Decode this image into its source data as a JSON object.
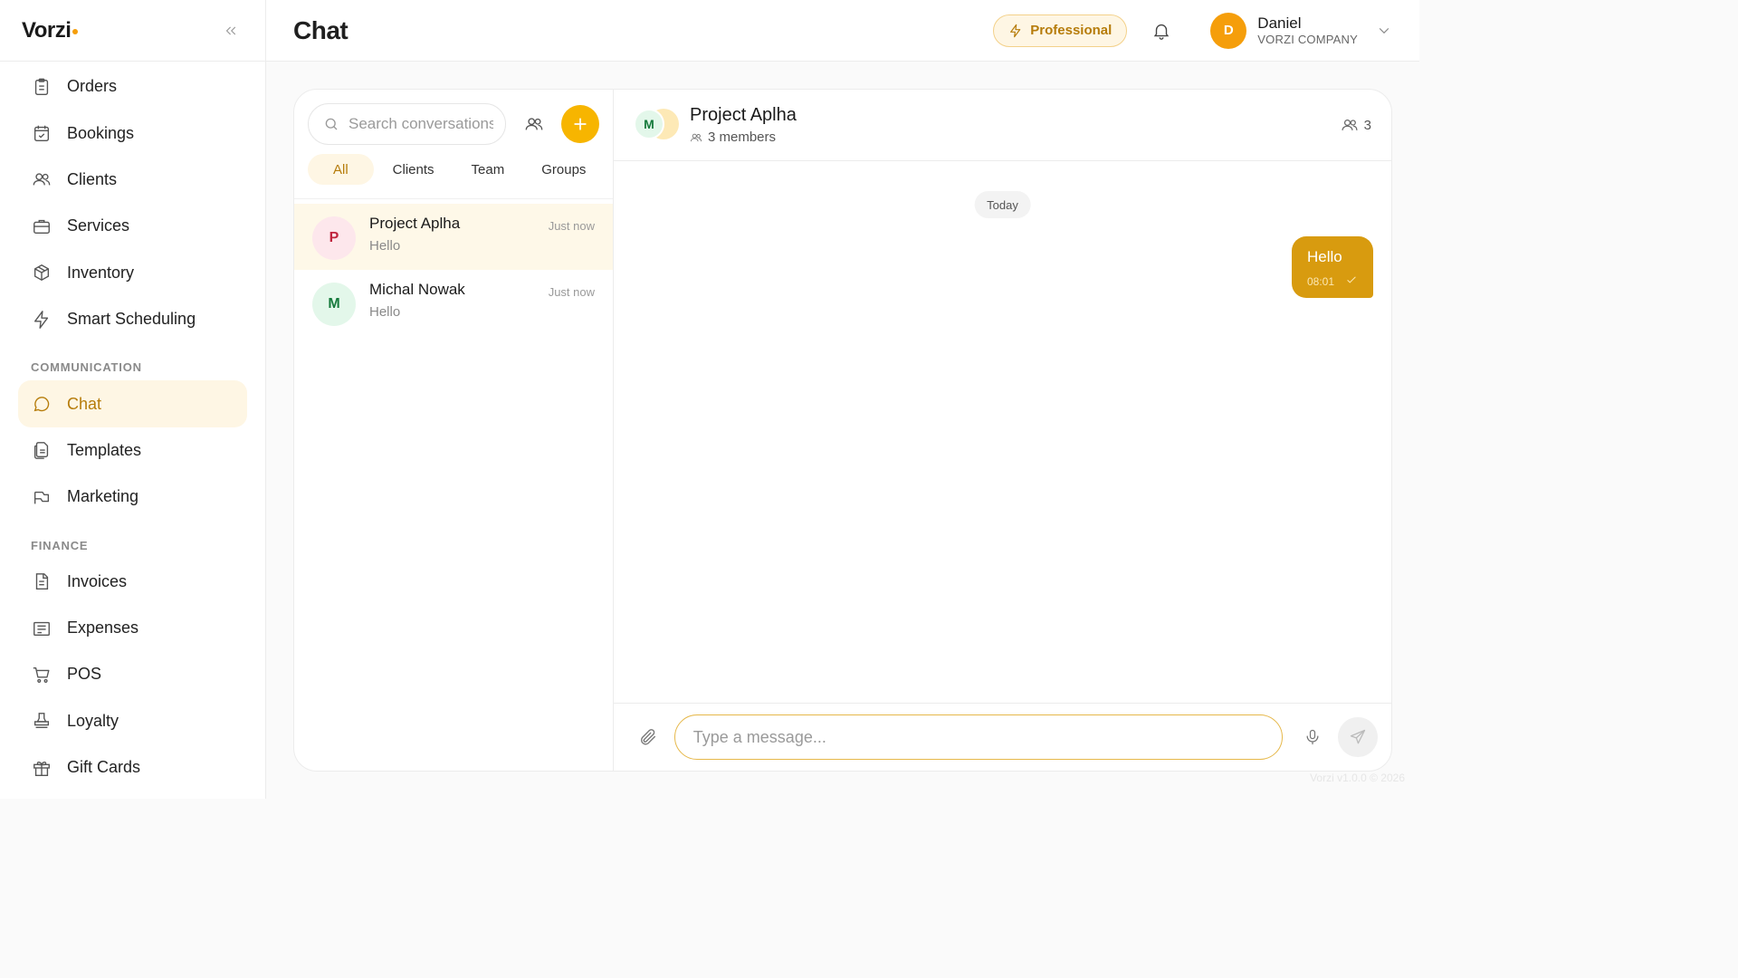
{
  "brand": {
    "name": "Vorzi",
    "accent": "#f59e0b"
  },
  "sidebar": {
    "items_top": [
      {
        "label": "Orders",
        "icon": "clipboard-icon"
      },
      {
        "label": "Bookings",
        "icon": "calendar-check-icon"
      },
      {
        "label": "Clients",
        "icon": "users-icon"
      },
      {
        "label": "Services",
        "icon": "briefcase-icon"
      },
      {
        "label": "Inventory",
        "icon": "box-icon"
      },
      {
        "label": "Smart Scheduling",
        "icon": "bolt-icon"
      }
    ],
    "section_communication": "COMMUNICATION",
    "items_communication": [
      {
        "label": "Chat",
        "icon": "chat-bubble-icon",
        "active": true
      },
      {
        "label": "Templates",
        "icon": "document-copy-icon"
      },
      {
        "label": "Marketing",
        "icon": "megaphone-icon"
      }
    ],
    "section_finance": "FINANCE",
    "items_finance": [
      {
        "label": "Invoices",
        "icon": "invoice-icon"
      },
      {
        "label": "Expenses",
        "icon": "receipt-icon"
      },
      {
        "label": "POS",
        "icon": "cart-icon"
      },
      {
        "label": "Loyalty",
        "icon": "stamp-icon"
      },
      {
        "label": "Gift Cards",
        "icon": "gift-icon"
      }
    ]
  },
  "header": {
    "title": "Chat",
    "plan": "Professional",
    "user": {
      "initial": "D",
      "name": "Daniel",
      "company": "VORZI COMPANY"
    }
  },
  "conversations": {
    "search_placeholder": "Search conversations...",
    "filters": [
      "All",
      "Clients",
      "Team",
      "Groups"
    ],
    "active_filter": "All",
    "items": [
      {
        "initial": "P",
        "name": "Project Aplha",
        "preview": "Hello",
        "time": "Just now",
        "active": true,
        "avatar_bg": "#fde7ec",
        "avatar_fg": "#c0263f"
      },
      {
        "initial": "M",
        "name": "Michal Nowak",
        "preview": "Hello",
        "time": "Just now",
        "active": false,
        "avatar_bg": "#e3f7ea",
        "avatar_fg": "#167a3c"
      }
    ]
  },
  "thread": {
    "name": "Project Aplha",
    "avatar_initial": "M",
    "members_text": "3 members",
    "members_count": "3",
    "day_label": "Today",
    "messages": [
      {
        "text": "Hello",
        "time": "08:01",
        "outgoing": true
      }
    ],
    "composer_placeholder": "Type a message..."
  },
  "footer": {
    "version": "Vorzi v1.0.0 © 2026"
  }
}
